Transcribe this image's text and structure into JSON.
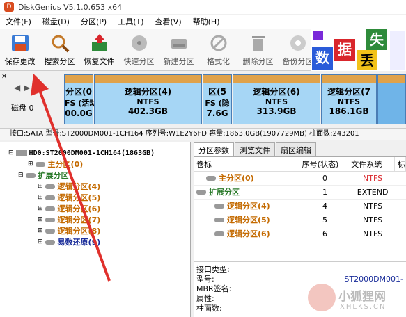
{
  "titlebar": {
    "title": "DiskGenius V5.1.0.653 x64"
  },
  "menu": [
    "文件(F)",
    "磁盘(D)",
    "分区(P)",
    "工具(T)",
    "查看(V)",
    "帮助(H)"
  ],
  "toolbar": {
    "items": [
      "保存更改",
      "搜索分区",
      "恢复文件",
      "快速分区",
      "新建分区",
      "格式化",
      "删除分区",
      "备份分区"
    ]
  },
  "ad": {
    "chars": [
      "数",
      "据",
      "丢",
      "失"
    ]
  },
  "diskmap": {
    "label": "磁盘 0",
    "partitions": [
      {
        "name": "分区(0",
        "fs": "FS (活动",
        "size": "00.0G"
      },
      {
        "name": "逻辑分区(4)",
        "fs": "NTFS",
        "size": "402.3GB"
      },
      {
        "name": "区(5",
        "fs": "FS (隐",
        "size": "7.6G"
      },
      {
        "name": "逻辑分区(6)",
        "fs": "NTFS",
        "size": "313.9GB"
      },
      {
        "name": "逻辑分区(7",
        "fs": "NTFS",
        "size": "186.1GB"
      }
    ]
  },
  "diskinfo": "接口:SATA  型号:ST2000DM001-1CH164   序列号:W1E2Y6FD  容量:1863.0GB(1907729MB)   柱面数:243201",
  "tree": {
    "root": "HD0:ST2000DM001-1CH164(1863GB)",
    "items": [
      {
        "label": "主分区(0)",
        "cls": "orange",
        "indent": 2
      },
      {
        "label": "扩展分区",
        "cls": "green",
        "indent": 1
      },
      {
        "label": "逻辑分区(4)",
        "cls": "orange",
        "indent": 3
      },
      {
        "label": "逻辑分区(5)",
        "cls": "orange",
        "indent": 3
      },
      {
        "label": "逻辑分区(6)",
        "cls": "orange",
        "indent": 3
      },
      {
        "label": "逻辑分区(7)",
        "cls": "orange",
        "indent": 3
      },
      {
        "label": "逻辑分区(8)",
        "cls": "orange",
        "indent": 3
      },
      {
        "label": "易数还原(9)",
        "cls": "blue",
        "indent": 3
      }
    ]
  },
  "tabs": [
    "分区参数",
    "浏览文件",
    "扇区编辑"
  ],
  "table": {
    "headers": [
      "卷标",
      "序号(状态)",
      "文件系统",
      "标"
    ],
    "rows": [
      {
        "label": "主分区(0)",
        "cls": "orange",
        "num": "0",
        "fs": "NTFS",
        "fscls": "red"
      },
      {
        "label": "扩展分区",
        "cls": "green",
        "num": "1",
        "fs": "EXTEND",
        "fscls": ""
      },
      {
        "label": "逻辑分区(4)",
        "cls": "orange",
        "num": "4",
        "fs": "NTFS",
        "fscls": ""
      },
      {
        "label": "逻辑分区(5)",
        "cls": "orange",
        "num": "5",
        "fs": "NTFS",
        "fscls": ""
      },
      {
        "label": "逻辑分区(6)",
        "cls": "orange",
        "num": "6",
        "fs": "NTFS",
        "fscls": ""
      }
    ]
  },
  "details": {
    "labels": [
      "接口类型:",
      "型号:",
      "MBR签名:",
      "属性:",
      "柱面数:"
    ],
    "model": "ST2000DM001-"
  },
  "watermark": {
    "text1": "小狐狸网",
    "text2": "XHLKS.CN"
  },
  "colors": {
    "arrow": "#e0302c",
    "partition": "#a6d6f5",
    "partitionCap": "#e0a24a"
  }
}
